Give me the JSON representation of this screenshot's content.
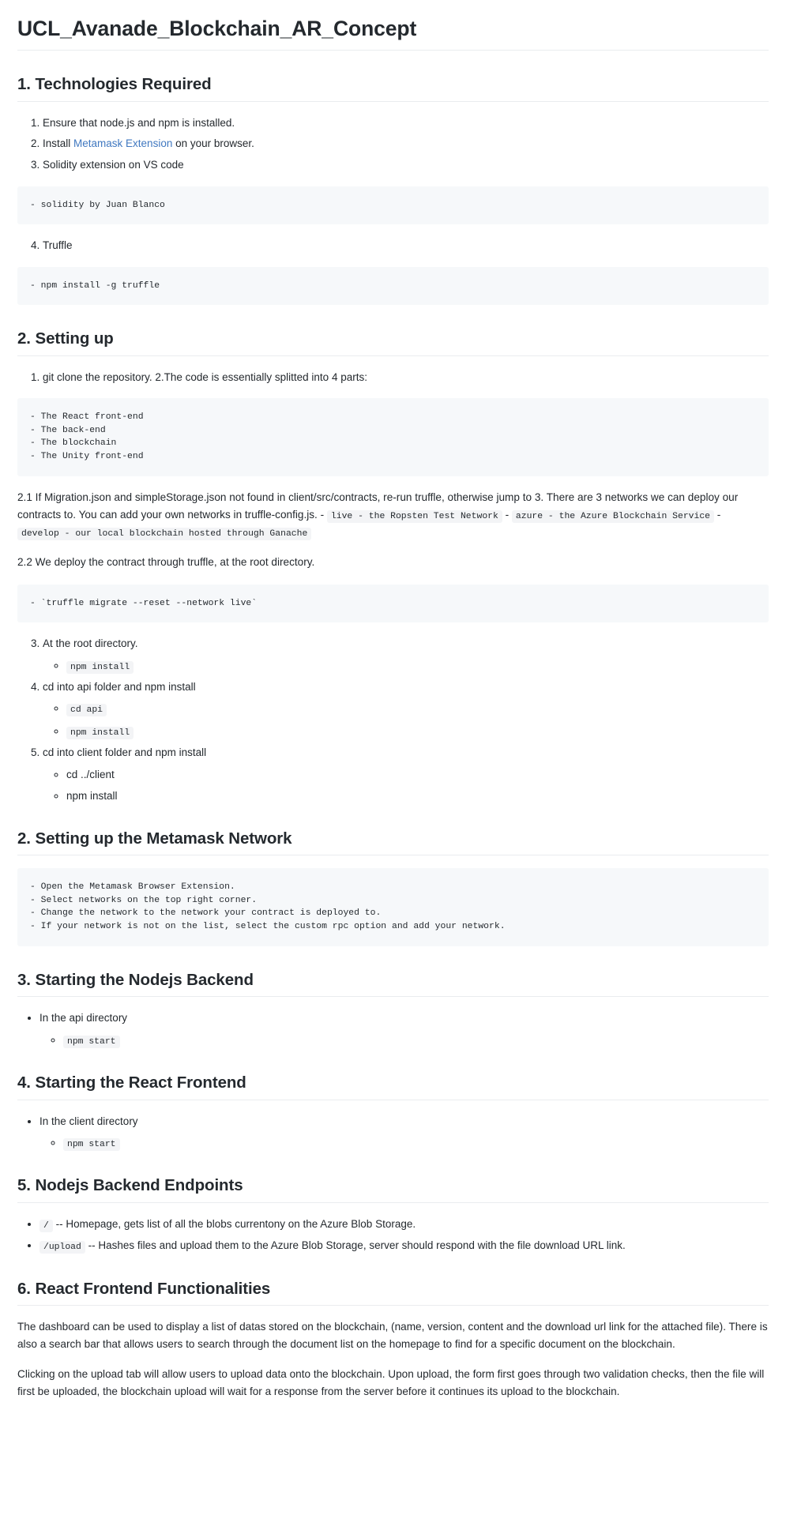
{
  "document": {
    "title": "UCL_Avanade_Blockchain_AR_Concept",
    "link_color": "#4078c0",
    "code_bg": "#f6f8fa",
    "inline_code_bg": "#f3f4f6",
    "text_color": "#24292e",
    "rule_color": "#eaecef"
  },
  "section1": {
    "heading": "1. Technologies Required",
    "item1": "Ensure that node.js and npm is installed.",
    "item2_prefix": "Install ",
    "item2_link": "Metamask Extension",
    "item2_suffix": " on your browser.",
    "item3": "Solidity extension on VS code",
    "code1": "- solidity by Juan Blanco",
    "item4": "Truffle",
    "code2": "- npm install -g truffle"
  },
  "section2": {
    "heading": "2. Setting up",
    "item1": "git clone the repository. 2.The code is essentially splitted into 4 parts:",
    "code1": "- The React front-end\n- The back-end\n- The blockchain\n- The Unity front-end",
    "para21_part1": "2.1 If Migration.json and simpleStorage.json not found in client/src/contracts, re-run truffle, otherwise jump to 3. There are 3 networks we can deploy our contracts to. You can add your own networks in truffle-config.js. - ",
    "para21_code1": "live - the Ropsten Test Network",
    "para21_mid1": " - ",
    "para21_code2": "azure - the Azure Blockchain Service",
    "para21_mid2": " - ",
    "para21_code3": "develop - our local blockchain hosted through Ganache",
    "para22": "2.2 We deploy the contract through truffle, at the root directory.",
    "code2": "- `truffle migrate --reset --network live`",
    "item3": "At the root directory.",
    "item3_sub1": "npm install",
    "item4": "cd into api folder and npm install",
    "item4_sub1": "cd api",
    "item4_sub2": "npm install",
    "item5": "cd into client folder and npm install",
    "item5_sub1": "cd ../client",
    "item5_sub2": "npm install"
  },
  "section3": {
    "heading": "2. Setting up the Metamask Network",
    "code1": "- Open the Metamask Browser Extension.\n- Select networks on the top right corner.\n- Change the network to the network your contract is deployed to.\n- If your network is not on the list, select the custom rpc option and add your network."
  },
  "section4": {
    "heading": "3. Starting the Nodejs Backend",
    "item1": "In the api directory",
    "item1_sub1": "npm start"
  },
  "section5": {
    "heading": "4. Starting the React Frontend",
    "item1": "In the client directory",
    "item1_sub1": "npm start"
  },
  "section6": {
    "heading": "5. Nodejs Backend Endpoints",
    "endpoint1_code": "/",
    "endpoint1_text": " -- Homepage, gets list of all the blobs currentony on the Azure Blob Storage.",
    "endpoint2_code": "/upload",
    "endpoint2_text": " -- Hashes files and upload them to the Azure Blob Storage, server should respond with the file download URL link."
  },
  "section7": {
    "heading": "6. React Frontend Functionalities",
    "para1": "The dashboard can be used to display a list of datas stored on the blockchain, (name, version, content and the download url link for the attached file). There is also a search bar that allows users to search through the document list on the homepage to find for a specific document on the blockchain.",
    "para2": "Clicking on the upload tab will allow users to upload data onto the blockchain. Upon upload, the form first goes through two validation checks, then the file will first be uploaded, the blockchain upload will wait for a response from the server before it continues its upload to the blockchain."
  }
}
